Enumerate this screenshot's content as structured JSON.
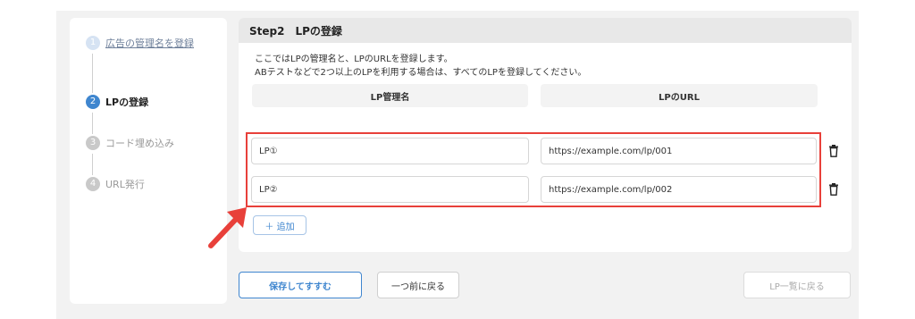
{
  "stepper": {
    "steps": [
      {
        "num": "1",
        "label": "広告の管理名を登録"
      },
      {
        "num": "2",
        "label": "LPの登録"
      },
      {
        "num": "3",
        "label": "コード埋め込み"
      },
      {
        "num": "4",
        "label": "URL発行"
      }
    ]
  },
  "card": {
    "title": "Step2　LPの登録",
    "description_line1": "ここではLPの管理名と、LPのURLを登録します。",
    "description_line2": "ABテストなどで2つ以上のLPを利用する場合は、すべてのLPを登録してください。",
    "columns": [
      "LP管理名",
      "LPのURL"
    ],
    "rows": [
      {
        "name": "LP①",
        "url": "https://example.com/lp/001"
      },
      {
        "name": "LP②",
        "url": "https://example.com/lp/002"
      }
    ],
    "add_label": "＋ 追加"
  },
  "footer": {
    "save_label": "保存してすすむ",
    "back_label": "一つ前に戻る",
    "list_label": "LP一覧に戻る"
  },
  "colors": {
    "accent": "#3f86cf",
    "highlight": "#e8403a"
  }
}
